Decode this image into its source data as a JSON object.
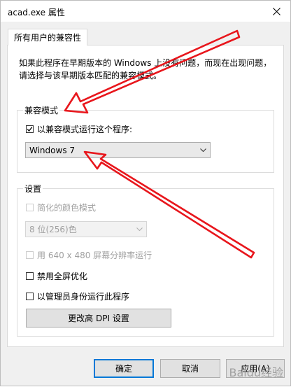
{
  "window": {
    "title": "acad.exe 属性",
    "close_glyph": "×"
  },
  "tab": {
    "label": "所有用户的兼容性"
  },
  "description": "如果此程序在早期版本的 Windows 上没有问题，而现在出现问题，请选择与该早期版本匹配的兼容模式。",
  "compat_mode": {
    "group_label": "兼容模式",
    "run_checkbox_label": "以兼容模式运行这个程序:",
    "run_checked": true,
    "os_selected": "Windows 7"
  },
  "settings": {
    "group_label": "设置",
    "reduced_color_label": "简化的颜色模式",
    "color_depth_selected": "8 位(256)色",
    "resolution_label": "用 640 x 480 屏幕分辨率运行",
    "fullscreen_opt_label": "禁用全屏优化",
    "run_as_admin_label": "以管理员身份运行此程序",
    "dpi_button_label": "更改高 DPI 设置"
  },
  "footer": {
    "ok_label": "确定",
    "cancel_label": "取消",
    "apply_label": "应用(A)"
  },
  "watermark": "Baidu经验",
  "colors": {
    "accent": "#0078d7",
    "annotation_arrow": "#e8161c"
  }
}
